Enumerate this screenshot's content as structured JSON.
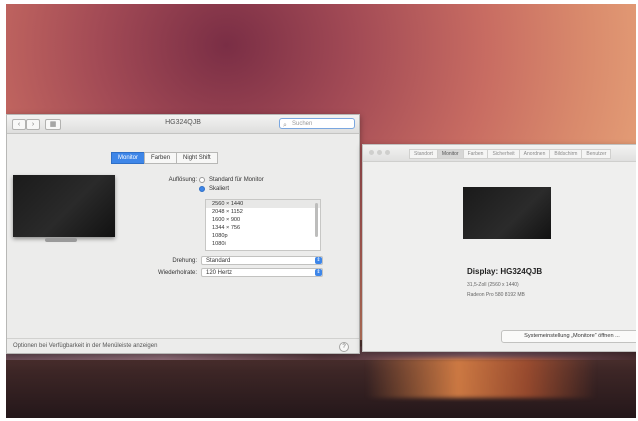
{
  "left_window": {
    "title": "HG324QJB",
    "search_placeholder": "Suchen",
    "nav": {
      "back": "‹",
      "forward": "›",
      "grid": "▦"
    },
    "tabs": [
      "Monitor",
      "Farben",
      "Night Shift"
    ],
    "aufloesung_label": "Auflösung:",
    "options": [
      "Standard für Monitor",
      "Skaliert"
    ],
    "resolutions": [
      "2560 × 1440",
      "2048 × 1152",
      "1600 × 900",
      "1344 × 756",
      "1080p",
      "1080i"
    ],
    "drehung_label": "Drehung:",
    "drehung_value": "Standard",
    "wiederhol_label": "Wiederholrate:",
    "wiederhol_value": "120 Hertz",
    "status": "Optionen bei Verfügbarkeit in der Menüleiste anzeigen",
    "help": "?"
  },
  "right_window": {
    "tabs": [
      "Standort",
      "Monitor",
      "Farben",
      "Sicherheit",
      "Anordnen",
      "Bildschirm",
      "Benutzer"
    ],
    "display_title": "Display: HG324QJB",
    "line1": "31,5-Zoll (2560 x 1440)",
    "line2": "Radeon Pro 580 8192 MB",
    "sys_button": "Systemeinstellung „Monitore“ öffnen ..."
  }
}
